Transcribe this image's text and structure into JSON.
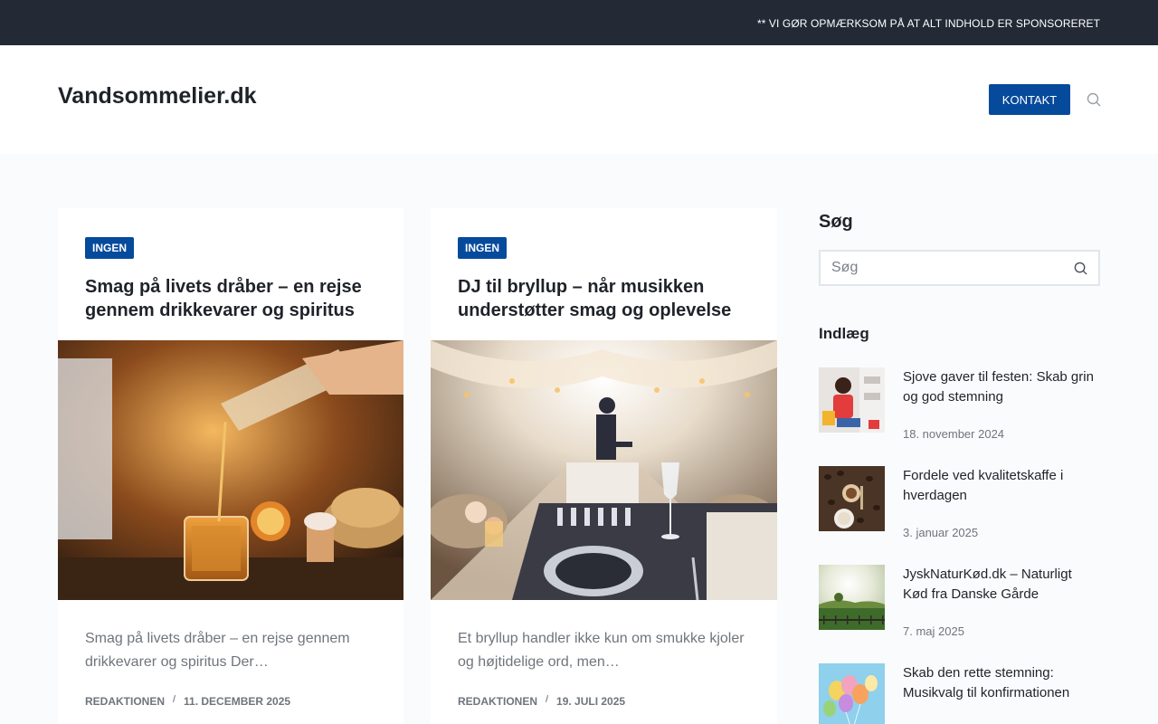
{
  "topbar": {
    "notice": "** VI GØR OPMÆRKSOM PÅ AT ALT INDHOLD ER SPONSORERET"
  },
  "header": {
    "logo": "Vandsommelier.dk",
    "contact_label": "KONTAKT",
    "search_icon": "search-icon"
  },
  "articles": [
    {
      "category": "INGEN",
      "title": "Smag på livets dråber – en rejse gennem drikkevarer og spiritus",
      "excerpt": "Smag på livets dråber – en rejse gennem drikkevarer og spiritus Der…",
      "author": "REDAKTIONEN",
      "date": "11. DECEMBER 2025"
    },
    {
      "category": "INGEN",
      "title": "DJ til bryllup – når musikken understøtter smag og oplevelse",
      "excerpt": "Et bryllup handler ikke kun om smukke kjoler og højtidelige ord, men…",
      "author": "REDAKTIONEN",
      "date": "19. JULI 2025"
    }
  ],
  "sidebar": {
    "search_heading": "Søg",
    "search_placeholder": "Søg",
    "posts_heading": "Indlæg",
    "posts": [
      {
        "title": "Sjove gaver til festen: Skab grin og god stemning",
        "date": "18. november 2024"
      },
      {
        "title": "Fordele ved kvalitetskaffe i hverdagen",
        "date": "3. januar 2025"
      },
      {
        "title": "JyskNaturKød.dk – Naturligt Kød fra Danske Gårde",
        "date": "7. maj 2025"
      },
      {
        "title": "Skab den rette stemning: Musikvalg til konfirmationen",
        "date": ""
      }
    ]
  },
  "colors": {
    "topbar": "#232a35",
    "accent": "#064a9c",
    "text": "#1f2329",
    "muted": "#6f757c"
  }
}
